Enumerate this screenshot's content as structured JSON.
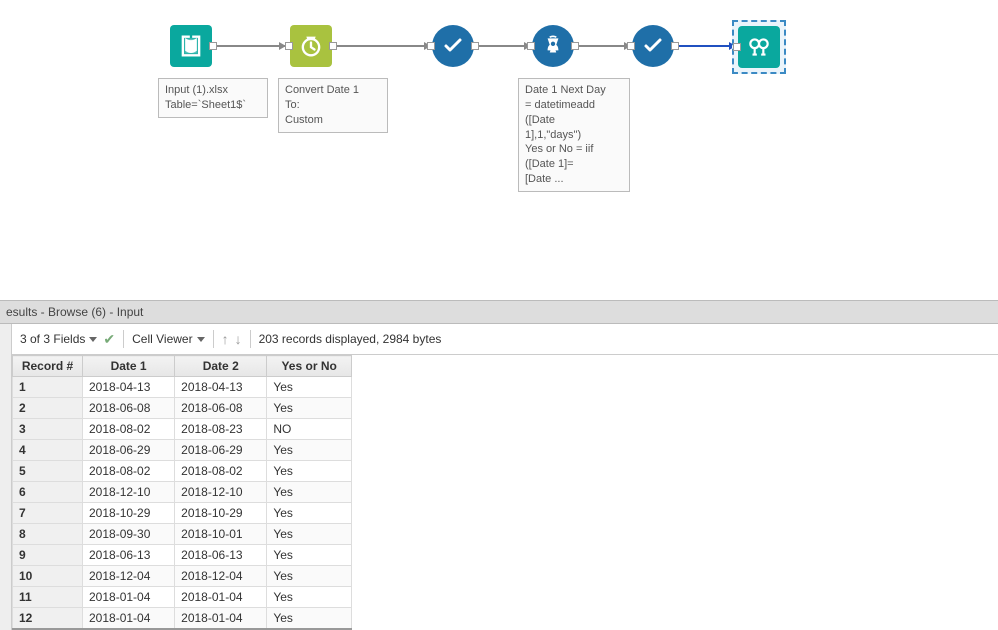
{
  "canvas": {
    "input": {
      "annotation_line1": "Input (1).xlsx",
      "annotation_line2": "Table=`Sheet1$`"
    },
    "datetime": {
      "annotation_line1": "Convert Date 1",
      "annotation_line2": "To:",
      "annotation_line3": "Custom"
    },
    "formula": {
      "annotation_line1": "Date 1 Next Day",
      "annotation_line2": "= datetimeadd",
      "annotation_line3": "([Date",
      "annotation_line4": "1],1,\"days\")",
      "annotation_line5": "Yes or No = iif",
      "annotation_line6": "([Date 1]=",
      "annotation_line7": "[Date ..."
    }
  },
  "results": {
    "title": "esults - Browse (6) - Input",
    "fields_label": "3 of 3 Fields",
    "cellviewer_label": "Cell Viewer",
    "status": "203 records displayed, 2984 bytes",
    "columns": [
      "Record #",
      "Date 1",
      "Date 2",
      "Yes or No"
    ],
    "rows": [
      {
        "rec": "1",
        "d1": "2018-04-13",
        "d2": "2018-04-13",
        "yn": "Yes"
      },
      {
        "rec": "2",
        "d1": "2018-06-08",
        "d2": "2018-06-08",
        "yn": "Yes"
      },
      {
        "rec": "3",
        "d1": "2018-08-02",
        "d2": "2018-08-23",
        "yn": "NO"
      },
      {
        "rec": "4",
        "d1": "2018-06-29",
        "d2": "2018-06-29",
        "yn": "Yes"
      },
      {
        "rec": "5",
        "d1": "2018-08-02",
        "d2": "2018-08-02",
        "yn": "Yes"
      },
      {
        "rec": "6",
        "d1": "2018-12-10",
        "d2": "2018-12-10",
        "yn": "Yes"
      },
      {
        "rec": "7",
        "d1": "2018-10-29",
        "d2": "2018-10-29",
        "yn": "Yes"
      },
      {
        "rec": "8",
        "d1": "2018-09-30",
        "d2": "2018-10-01",
        "yn": "Yes"
      },
      {
        "rec": "9",
        "d1": "2018-06-13",
        "d2": "2018-06-13",
        "yn": "Yes"
      },
      {
        "rec": "10",
        "d1": "2018-12-04",
        "d2": "2018-12-04",
        "yn": "Yes"
      },
      {
        "rec": "11",
        "d1": "2018-01-04",
        "d2": "2018-01-04",
        "yn": "Yes"
      },
      {
        "rec": "12",
        "d1": "2018-01-04",
        "d2": "2018-01-04",
        "yn": "Yes"
      }
    ]
  }
}
